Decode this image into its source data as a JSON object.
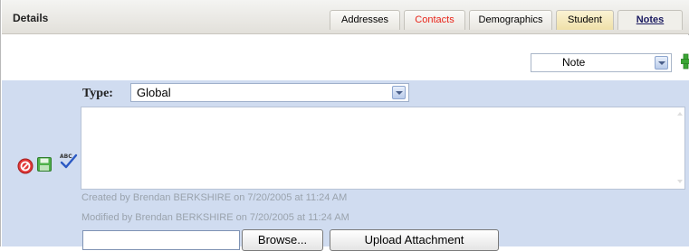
{
  "header": {
    "title": "Details",
    "tabs": [
      {
        "label": "Addresses",
        "color": "#000000"
      },
      {
        "label": "Contacts",
        "color": "#e8251a"
      },
      {
        "label": "Demographics",
        "color": "#000000"
      },
      {
        "label": "Student",
        "color": "#000000"
      },
      {
        "label": "Notes",
        "color": "#1a1a60",
        "active": true
      }
    ]
  },
  "toolbar": {
    "note_type_select": {
      "value": "Note"
    },
    "add_icon": "plus-icon"
  },
  "note": {
    "type_label": "Type:",
    "type_value": "Global",
    "body": "",
    "created": "Created by Brendan BERKSHIRE on 7/20/2005 at 11:24 AM",
    "modified": "Modified by Brendan BERKSHIRE on 7/20/2005 at 11:24 AM",
    "actions": {
      "cancel_icon": "cancel-icon",
      "save_icon": "save-icon",
      "spellcheck_icon": "spellcheck-icon"
    }
  },
  "attachment": {
    "file_value": "",
    "browse_label": "Browse...",
    "upload_label": "Upload Attachment"
  },
  "colors": {
    "panel_bg": "#d0dcf0",
    "contacts_tab": "#e8251a",
    "add_green": "#3aa534"
  }
}
